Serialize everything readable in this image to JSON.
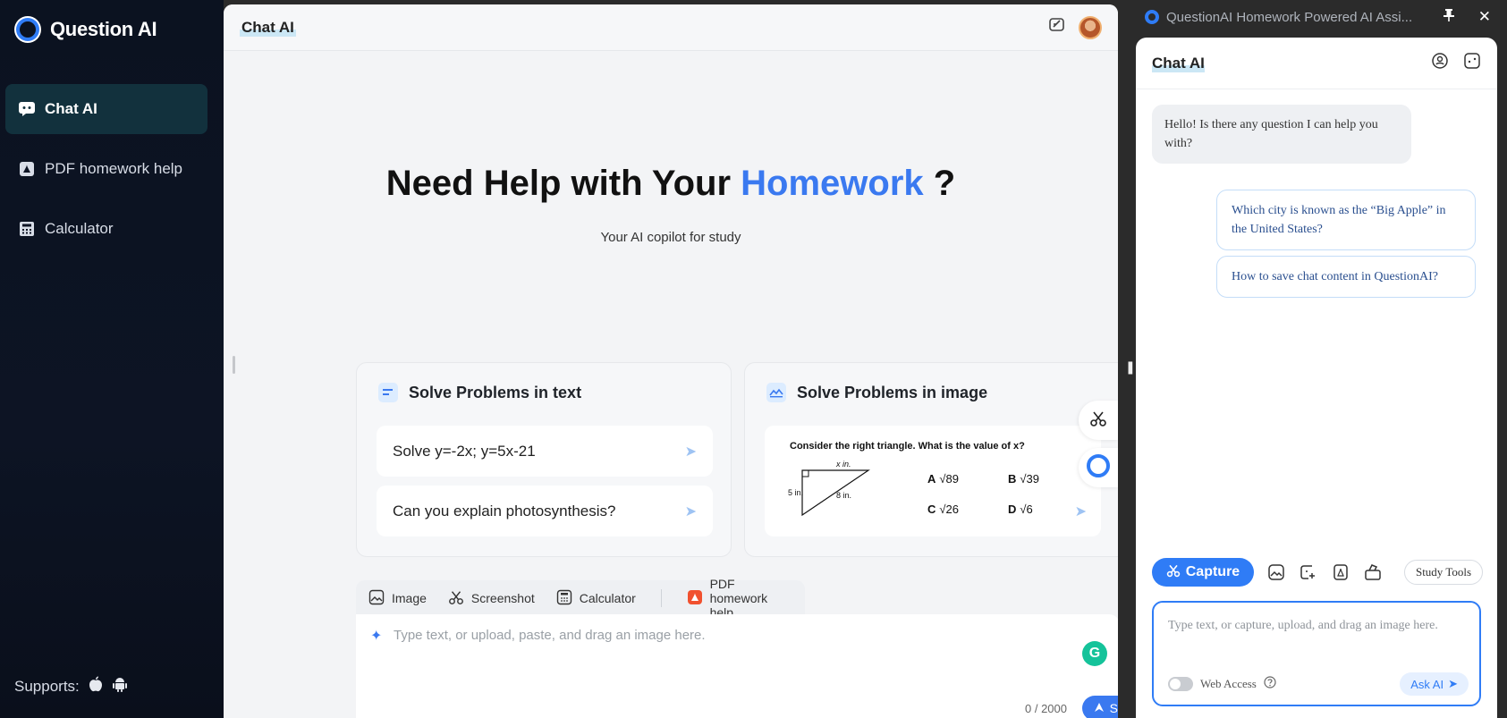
{
  "sidebar": {
    "brand": "Question AI",
    "items": [
      {
        "label": "Chat AI",
        "icon": "chat-icon",
        "active": true
      },
      {
        "label": "PDF homework help",
        "icon": "pdf-icon",
        "active": false
      },
      {
        "label": "Calculator",
        "icon": "calculator-icon",
        "active": false
      }
    ],
    "supports_label": "Supports:"
  },
  "main": {
    "title": "Chat AI",
    "hero": {
      "title_prefix": "Need Help with Your ",
      "title_accent": "Homework",
      "title_suffix": " ?",
      "subtitle": "Your AI copilot for study"
    },
    "card_text": {
      "title": "Solve Problems in text",
      "prompts": [
        "Solve y=-2x; y=5x-21",
        "Can you explain photosynthesis?"
      ]
    },
    "card_image": {
      "title": "Solve Problems in image",
      "question": "Consider the right triangle.  What is the value of x?",
      "side_top": "x in.",
      "side_left": "5 in.",
      "side_hyp": "8 in.",
      "options": [
        {
          "letter": "A",
          "value": "√89"
        },
        {
          "letter": "B",
          "value": "√39"
        },
        {
          "letter": "C",
          "value": "√26"
        },
        {
          "letter": "D",
          "value": "√6"
        }
      ]
    },
    "toolbar": {
      "image": "Image",
      "screenshot": "Screenshot",
      "calculator": "Calculator",
      "pdf": "PDF homework help"
    },
    "composer": {
      "placeholder": "Type text, or upload, paste, and drag an image here.",
      "counter": "0 / 2000",
      "send": "Send"
    }
  },
  "side": {
    "window_title": "QuestionAI Homework Powered AI Assi...",
    "title": "Chat AI",
    "bot_message": "Hello! Is there any question I can help you with?",
    "suggestions": [
      "Which city is known as the “Big Apple” in the United States?",
      "How to save chat content in QuestionAI?"
    ],
    "capture": "Capture",
    "study_tools": "Study Tools",
    "input_placeholder": "Type text, or capture, upload, and drag an image here.",
    "web_access": "Web Access",
    "ask_ai": "Ask AI"
  },
  "colors": {
    "accent": "#3a79f0",
    "sidebar_bg": "#0b1220",
    "sidebar_active": "#12313d"
  }
}
